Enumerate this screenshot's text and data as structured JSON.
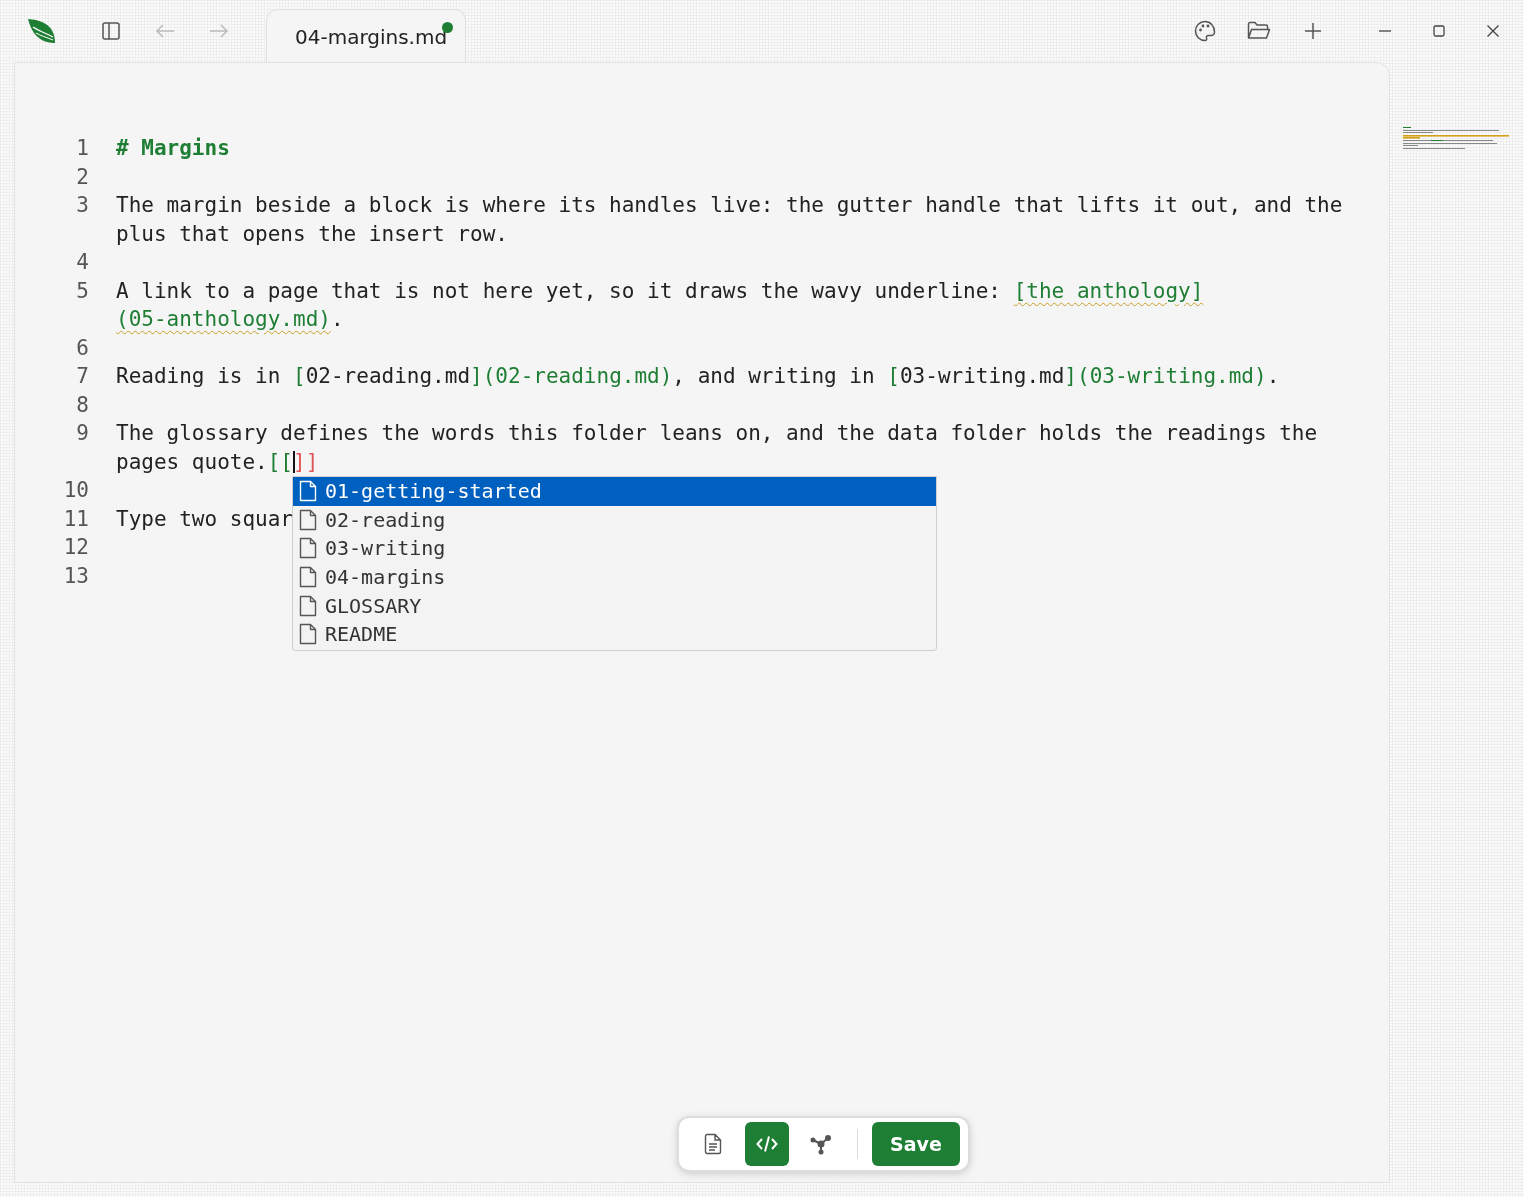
{
  "tab": {
    "title": "04-margins.md",
    "modified": true
  },
  "nav": {
    "back_disabled": true,
    "forward_disabled": true
  },
  "editor": {
    "lines": [
      {
        "number": "1",
        "rows": [
          {
            "segments": [
              {
                "kind": "heading",
                "text": "# Margins"
              }
            ]
          }
        ]
      },
      {
        "number": "2"
      },
      {
        "number": "3",
        "rows": [
          {
            "segments": [
              {
                "kind": "plain",
                "text": "The margin beside a block is where its handles live: the gutter handle that lifts it out, and the"
              }
            ]
          },
          {
            "segments": [
              {
                "kind": "plain",
                "text": "plus that opens the insert row."
              }
            ]
          }
        ]
      },
      {
        "number": "4"
      },
      {
        "number": "5",
        "rows": [
          {
            "segments": [
              {
                "kind": "plain",
                "text": "A link to a page that is not here yet, so it draws the wavy underline: "
              },
              {
                "kind": "broken-link",
                "text": "[the anthology]"
              }
            ]
          },
          {
            "segments": [
              {
                "kind": "broken-link",
                "text": "(05-anthology.md)"
              },
              {
                "kind": "plain",
                "text": "."
              }
            ]
          }
        ]
      },
      {
        "number": "6"
      },
      {
        "number": "7",
        "rows": [
          {
            "segments": [
              {
                "kind": "plain",
                "text": "Reading is in "
              },
              {
                "kind": "punct",
                "text": "["
              },
              {
                "kind": "plain",
                "text": "02-reading.md"
              },
              {
                "kind": "punct",
                "text": "]"
              },
              {
                "kind": "url",
                "text": "(02-reading.md)"
              },
              {
                "kind": "plain",
                "text": ", and writing in "
              },
              {
                "kind": "punct",
                "text": "["
              },
              {
                "kind": "plain",
                "text": "03-writing.md"
              },
              {
                "kind": "punct",
                "text": "]"
              },
              {
                "kind": "url",
                "text": "(03-writing.md)"
              },
              {
                "kind": "plain",
                "text": "."
              }
            ]
          }
        ]
      },
      {
        "number": "8"
      },
      {
        "number": "9",
        "rows": [
          {
            "segments": [
              {
                "kind": "plain",
                "text": "The glossary defines the words this folder leans on, and the data folder holds the readings the"
              }
            ]
          },
          {
            "segments": [
              {
                "kind": "plain",
                "text": "pages quote."
              },
              {
                "kind": "punct",
                "text": "[["
              },
              {
                "kind": "cursor"
              },
              {
                "kind": "unmatched",
                "text": "]]"
              }
            ]
          }
        ]
      },
      {
        "number": "10"
      },
      {
        "number": "11",
        "rows": [
          {
            "segments": [
              {
                "kind": "plain",
                "text": "Type two squar"
              }
            ]
          }
        ]
      },
      {
        "number": "12"
      },
      {
        "number": "13"
      }
    ]
  },
  "autocomplete": {
    "items": [
      {
        "label": "01-getting-started",
        "selected": true
      },
      {
        "label": "02-reading",
        "selected": false
      },
      {
        "label": "03-writing",
        "selected": false
      },
      {
        "label": "04-margins",
        "selected": false
      },
      {
        "label": "GLOSSARY",
        "selected": false
      },
      {
        "label": "README",
        "selected": false
      }
    ]
  },
  "toolbar": {
    "modes": [
      {
        "kind": "preview",
        "selected": false
      },
      {
        "kind": "source",
        "selected": true
      },
      {
        "kind": "graph",
        "selected": false
      }
    ],
    "save": "Save"
  }
}
